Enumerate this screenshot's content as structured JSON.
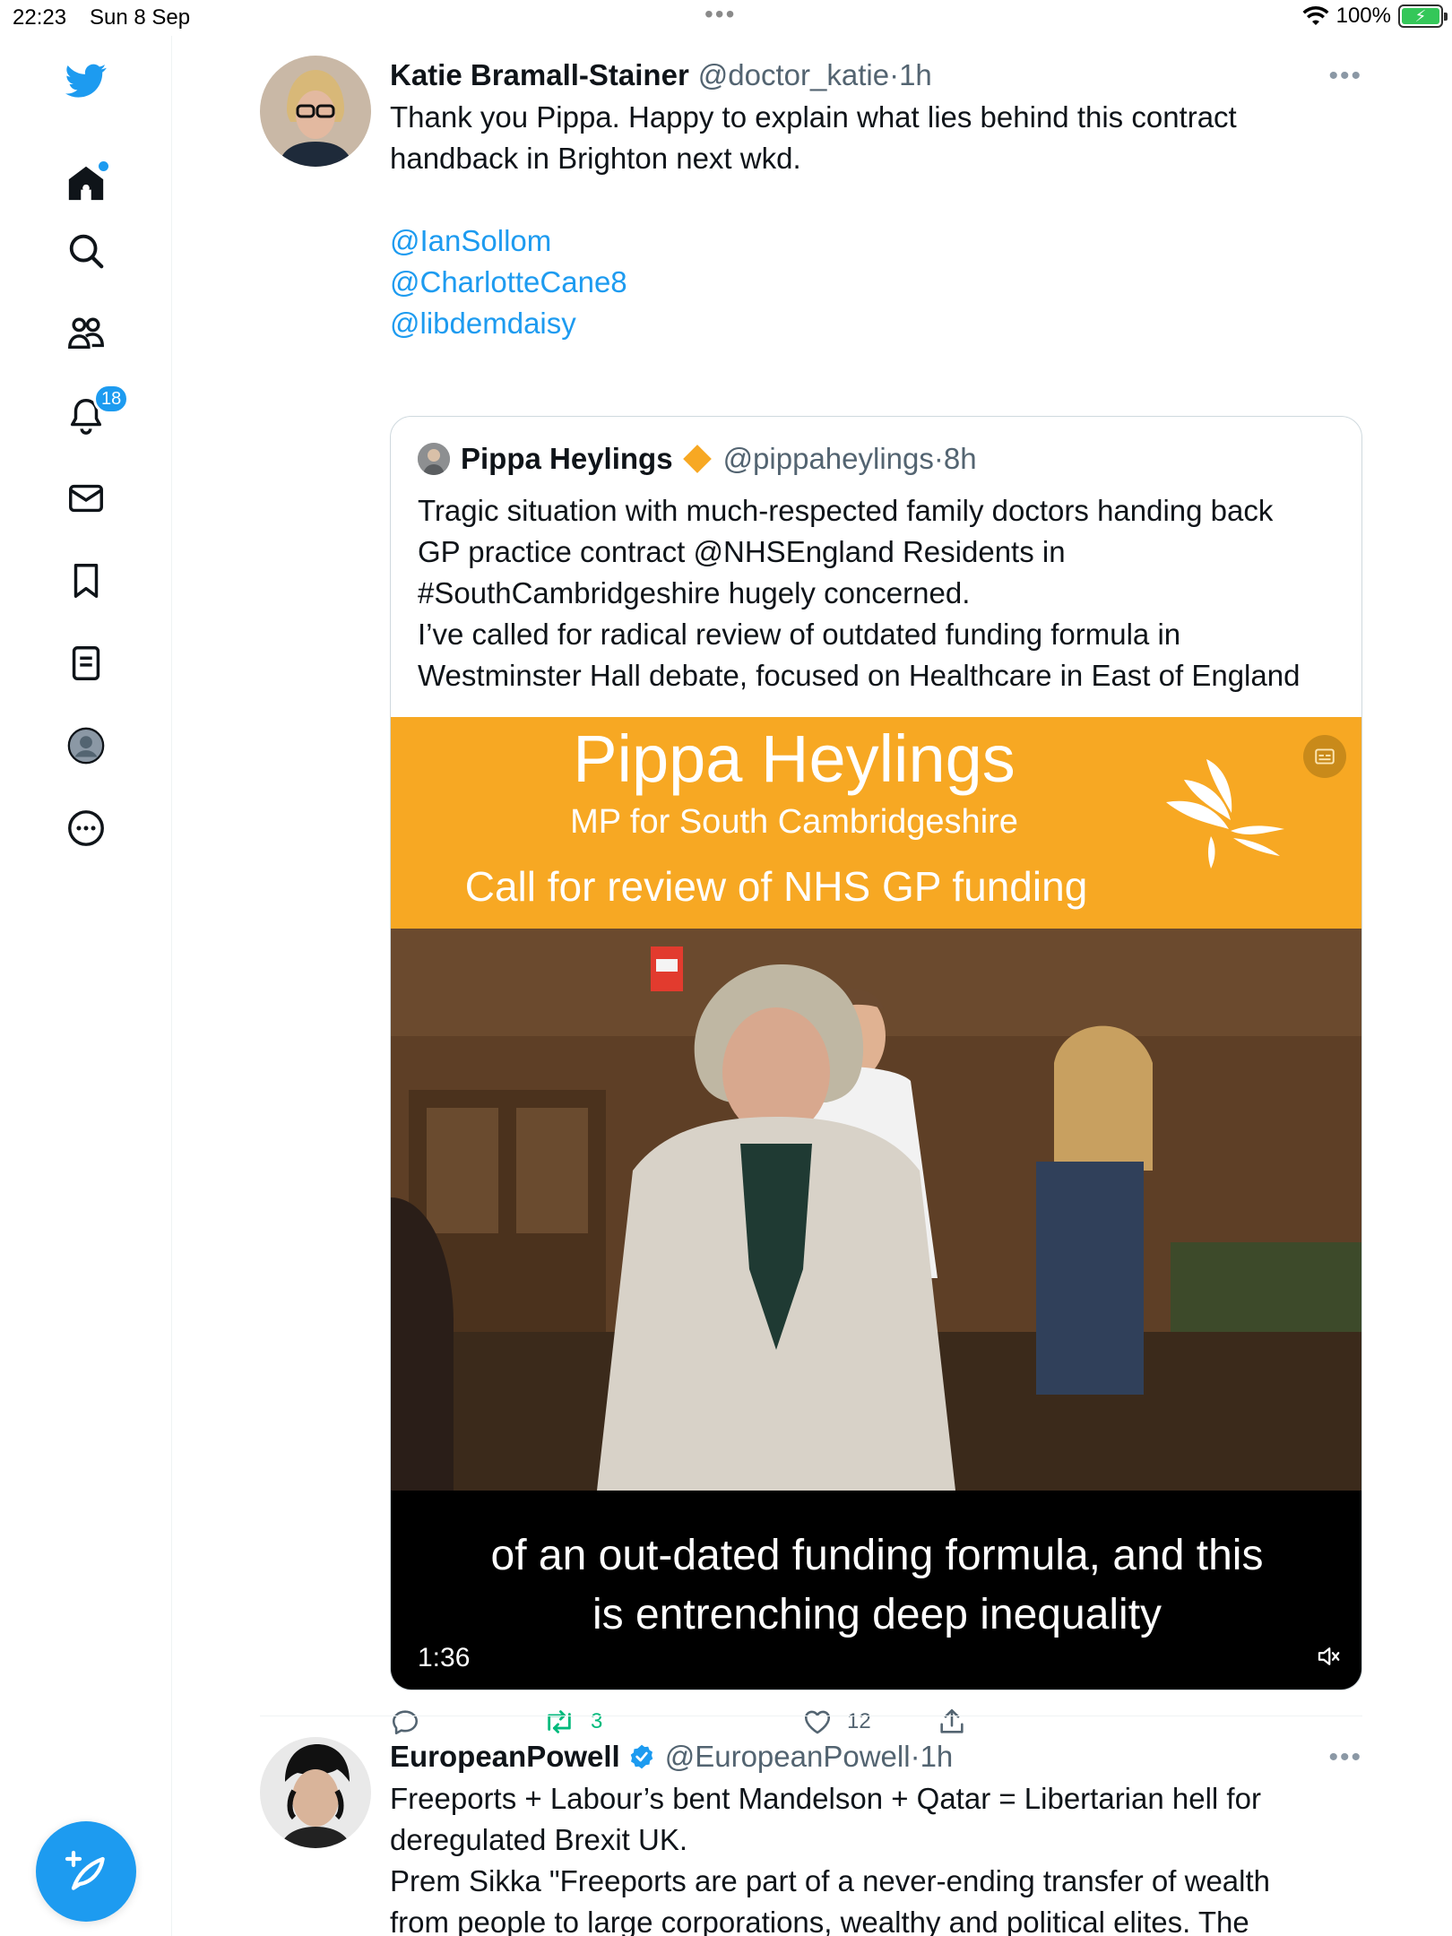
{
  "status_bar": {
    "time": "22:23",
    "date": "Sun 8 Sep",
    "battery": "100%"
  },
  "sidebar": {
    "notifications_badge": "18",
    "items": [
      "twitter-logo",
      "home-icon",
      "search-icon",
      "communities-icon",
      "notifications-icon",
      "messages-icon",
      "bookmarks-icon",
      "lists-icon",
      "profile-icon",
      "more-icon"
    ]
  },
  "tweet1": {
    "name": "Katie Bramall-Stainer",
    "handle": "@doctor_katie",
    "separator": "·",
    "time": "1h",
    "text_line1": "Thank you Pippa. Happy to explain what lies behind this contract",
    "text_line2": "handback in Brighton next wkd.",
    "mentions": [
      "@IanSollom",
      "@CharlotteCane8",
      "@libdemdaisy"
    ],
    "quote": {
      "name": "Pippa Heylings",
      "handle": "@pippaheylings",
      "separator": "·",
      "time": "8h",
      "text_lines": [
        "Tragic situation with much-respected family doctors handing back",
        "GP practice contract @NHSEngland Residents in",
        "#SouthCambridgeshire hugely concerned.",
        "I’ve called for radical review of outdated funding formula in",
        "Westminster Hall debate, focused on Healthcare in East of England"
      ],
      "media": {
        "banner_title": "Pippa Heylings",
        "banner_subtitle": "MP for South Cambridgeshire",
        "banner_call": "Call for review of NHS GP funding",
        "caption_line1": "of an out-dated funding formula, and this",
        "caption_line2": "is entrenching deep inequality",
        "duration": "1:36"
      }
    },
    "actions": {
      "retweets": "3",
      "likes": "12"
    }
  },
  "tweet2": {
    "name": "EuropeanPowell",
    "handle": "@EuropeanPowell",
    "separator": "·",
    "time": "1h",
    "text_lines": [
      "Freeports + Labour’s bent Mandelson + Qatar = Libertarian hell for",
      "deregulated Brexit UK.",
      "Prem Sikka \"Freeports are part of a never-ending transfer of wealth",
      "from people to large corporations, wealthy and political elites. The"
    ]
  },
  "colors": {
    "accent": "#1d9bf0",
    "retweet": "#00ba7c",
    "banner": "#f7a823"
  }
}
